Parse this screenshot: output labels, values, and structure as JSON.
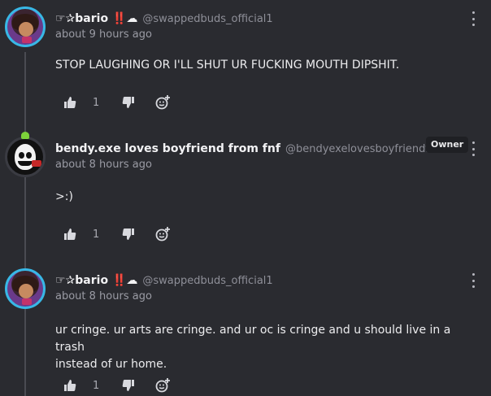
{
  "comments": [
    {
      "username": "☞✰bario ‼️☁",
      "handle": "@swappedbuds_official1",
      "timestamp": "about 9 hours ago",
      "lines": [
        "STOP LAUGHING OR I'LL SHUT UR FUCKING MOUTH DIPSHIT."
      ],
      "likes": "1",
      "avatar": "character-avatar"
    },
    {
      "username": "bendy.exe loves boyfriend from fnf",
      "handle": "@bendyexelovesboyfriendfro...",
      "badge": "Owner",
      "timestamp": "about 8 hours ago",
      "lines": [
        ">:)"
      ],
      "likes": "1",
      "avatar": "bendy-avatar"
    },
    {
      "username": "☞✰bario ‼️☁",
      "handle": "@swappedbuds_official1",
      "timestamp": "about 8 hours ago",
      "lines": [
        "ur cringe. ur arts are cringe. and ur oc is cringe and u should live in a trash",
        "instead of ur home."
      ],
      "likes": "1",
      "avatar": "character-avatar"
    }
  ],
  "icons": {
    "like": "thumbs-up-icon",
    "dislike": "thumbs-down-icon",
    "react": "add-reaction-icon",
    "more": "more-vertical-icon"
  },
  "colors": {
    "background": "#2a2b30",
    "avatar_ring": "#38b8e6",
    "crown": "#7cd13a"
  }
}
